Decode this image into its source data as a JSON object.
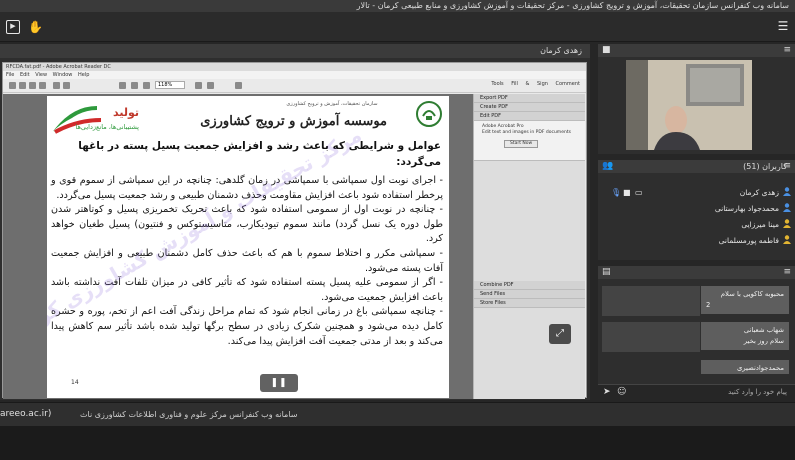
{
  "window": {
    "title": "سامانه وب کنفرانس سازمان تحقیقات، آموزش و ترویج کشاورزی - مرکز تحقیقات و آموزش کشاورزی و منابع طبیعی کرمان - تالار"
  },
  "share_pod": {
    "title": "زهدی کرمان"
  },
  "acrobat": {
    "titlebar": "RFCDA.fat.pdf - Adobe Acrobat Reader DC",
    "menu": "File  Edit  View  Window  Help",
    "tabs": "Tools  Fill & Sign  Comment",
    "zoom": "118%",
    "side_sections": [
      "Export PDF",
      "Create PDF",
      "Edit PDF",
      "Combine PDF",
      "Send Files",
      "Store Files"
    ],
    "acrobat_pro": "Adobe Acrobat Pro",
    "acrobat_pro_desc": "Edit text and images in PDF documents",
    "start_button": "Start Now"
  },
  "document": {
    "org_small": "سازمان تحقیقات، آموزش و ترویج کشاورزی",
    "org_main": "موسسه آموزش و ترویج کشاورزی",
    "logo_text": "جهاد کشاورزی",
    "brand_title": "تولید",
    "brand_sub": "پشتیبانی‌ها، مانع‌زدایی‌ها",
    "heading": "عوامل و شرایطی که باعث رشد و افزایش جمعیت پسیل پسته در باغها می‌گردد:",
    "paragraphs": [
      "- اجرای نوبت اول سمپاشی با سمپاشی در زمان گلدهی: چنانچه در این سمپاشی از سموم قوی و پرخطر استفاده شود باعث افزایش مقاومت وحذف دشمنان طبیعی و رشد جمعیت پسیل می‌گردد.",
      "- چنانچه در نوبت اول از سمومی استفاده شود که باعث تحریک تخمریزی پسیل و کوتاهتر شدن طول دوره یک نسل گردد) مانند سموم تیودیکارب، متاسیستوکس و فنتیون) پسیل طغیان خواهد کرد.",
      "- سمپاشی مکرر و اختلاط سموم با هم که باعث حذف کامل دشمنان طبیعی و افزایش جمعیت آفات پسته می‌شود.",
      "- اگر از سمومی علیه پسیل پسته استفاده شود که تأثیر کافی در میزان تلفات آفت نداشته باشد باعث افزایش جمعیت می‌شود.",
      "- چنانچه سمپاشی باغ در زمانی انجام شود که تمام مراحل زندگی آفت اعم از تخم، پوره و حشره کامل دیده می‌شود و همچنین شکرک زیادی در سطح برگها تولید شده باشد تأثیر سم کاهش پیدا می‌کند و بعد از مدتی جمعیت آفت افزایش پیدا می‌کند."
    ],
    "watermark": "مرکز تحقیقات و آموزش کشاورزی کرمان",
    "page_number": "14"
  },
  "bottom": {
    "url": "areeo.ac.ir)",
    "org": "سامانه وب کنفرانس مرکز علوم و فناوری اطلاعات کشاورزی ناث"
  },
  "attendees": {
    "title": "کاربران (51)",
    "list": [
      {
        "name": "زهدی کرمان",
        "color": "#4a90e2"
      },
      {
        "name": "محمدجواد بهارستانی",
        "color": "#4a90e2"
      },
      {
        "name": "مینا میرزایی",
        "color": "#e3b532"
      },
      {
        "name": "فاطمه پورمسلمانی",
        "color": "#e3b532"
      }
    ]
  },
  "chat": {
    "messages": [
      {
        "sender": "محبوبه کاکویی",
        "text": "با سلام",
        "extra": "2"
      },
      {
        "sender": "شهاب شعبانی",
        "text": "سلام روز بخیر"
      },
      {
        "sender": "محمدجوادنصیری",
        "text": ""
      }
    ],
    "placeholder": "پیام خود را وارد کنید"
  }
}
